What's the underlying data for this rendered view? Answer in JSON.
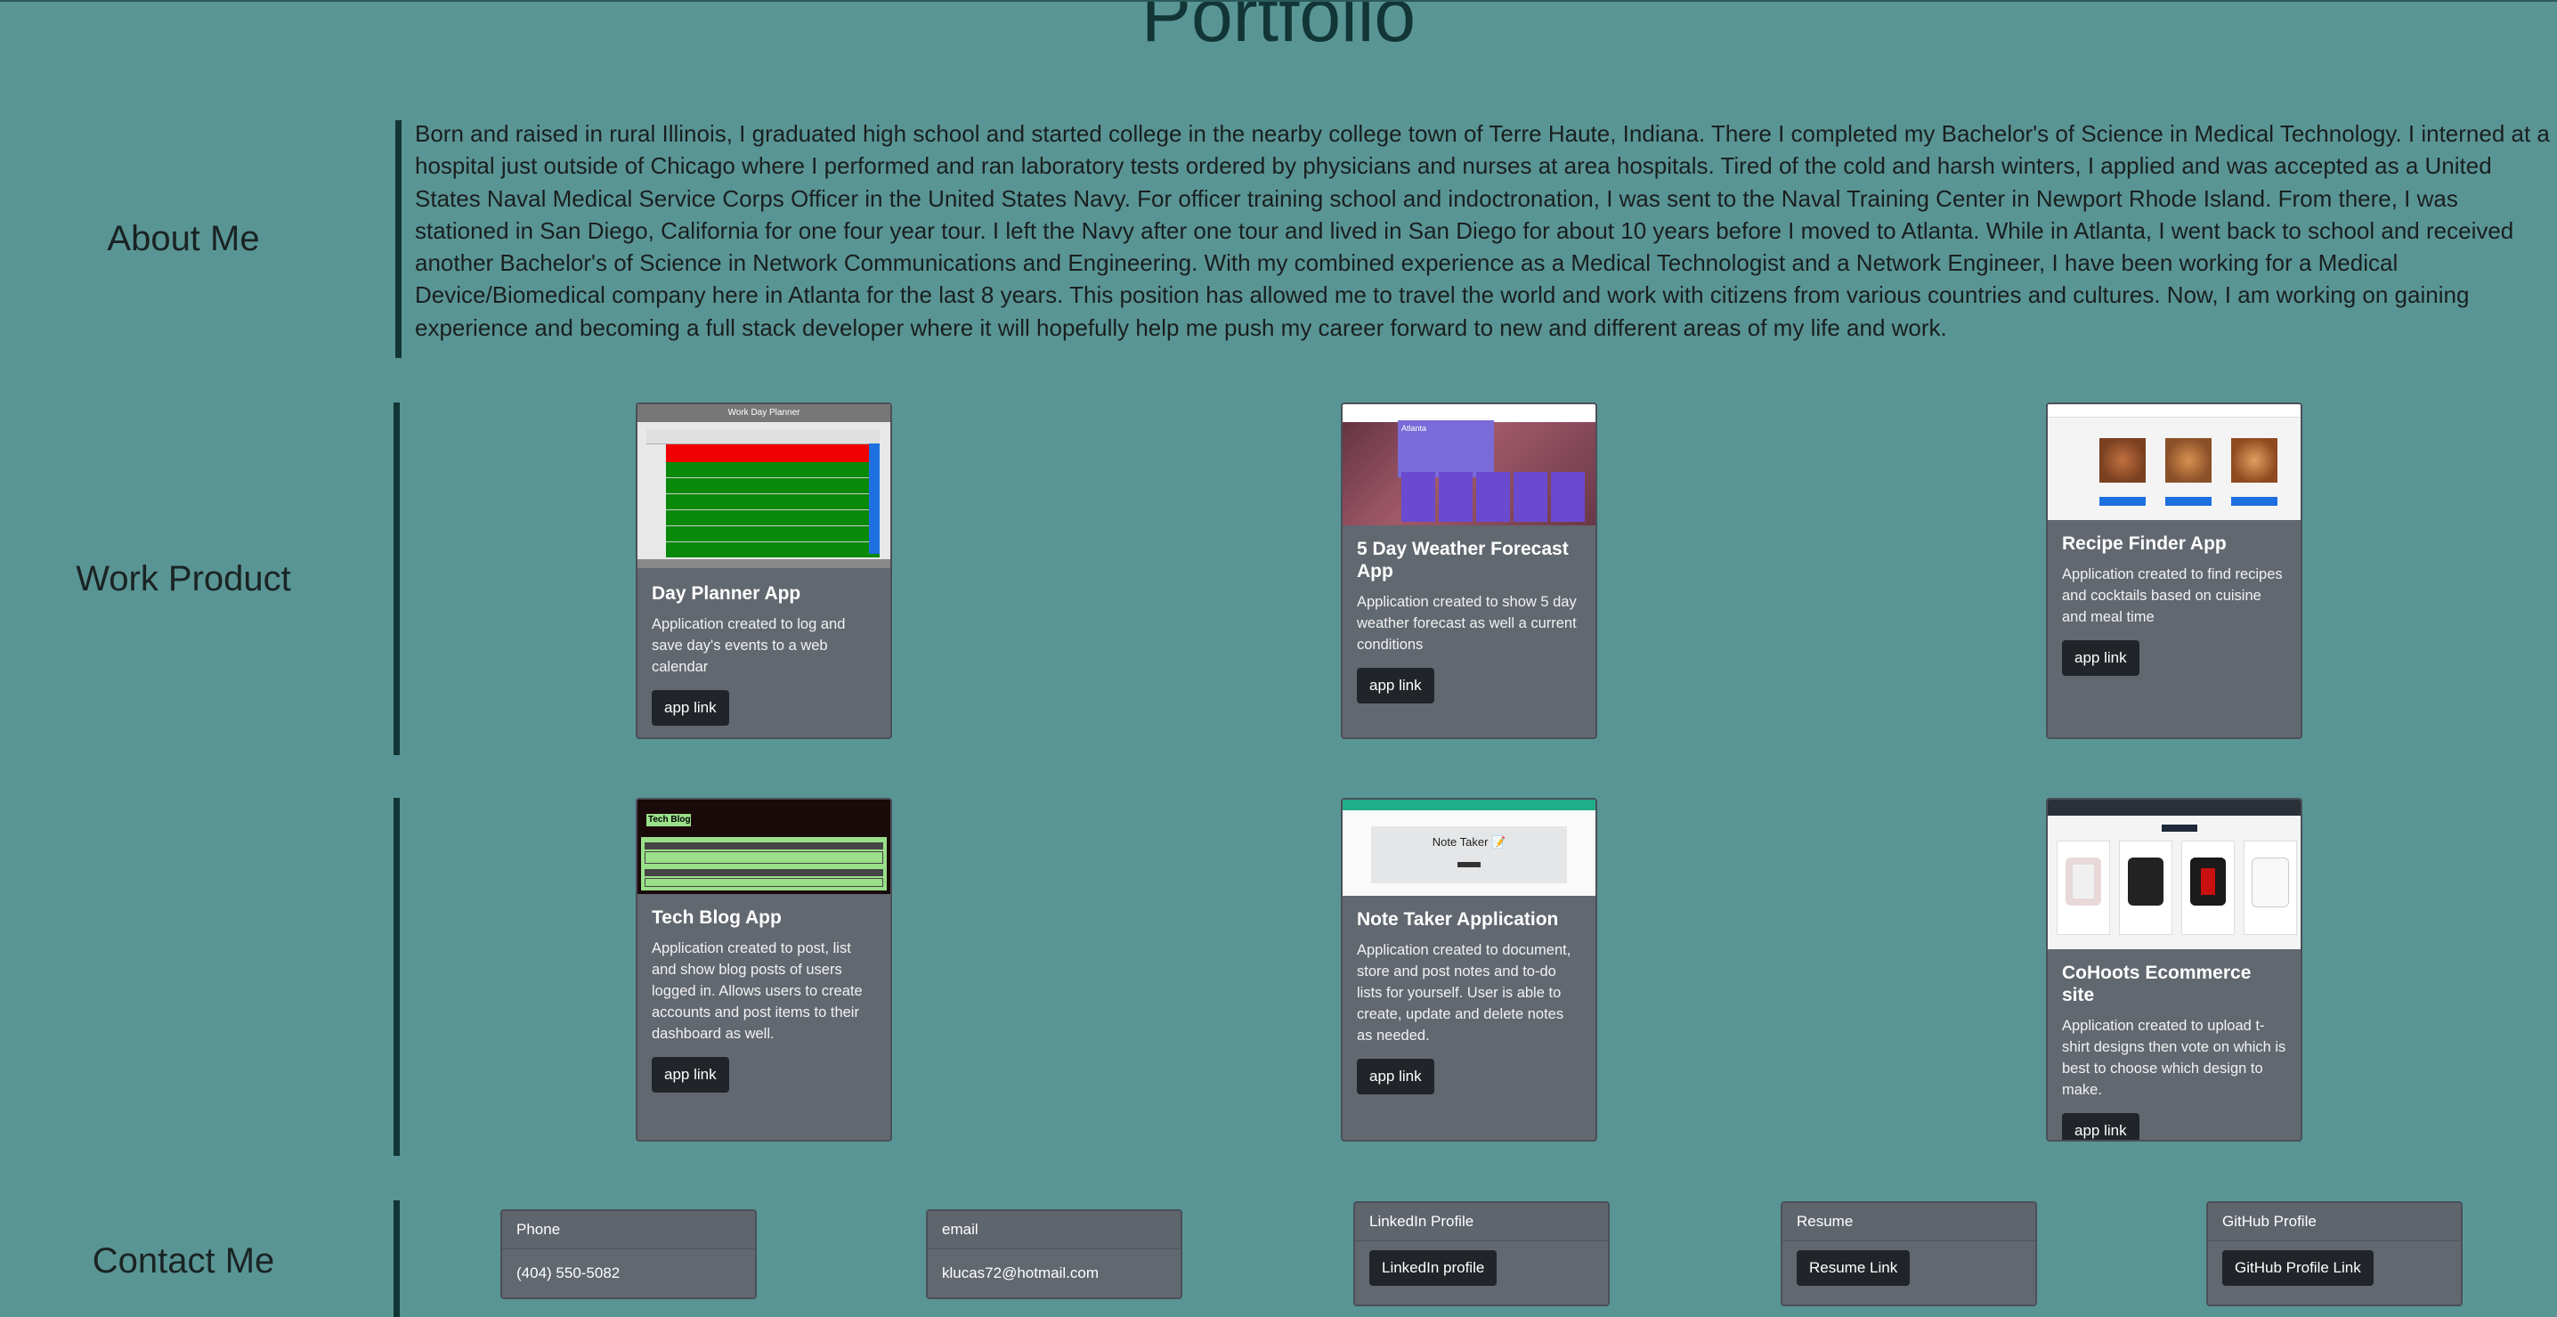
{
  "page": {
    "title": "Portfolio"
  },
  "colors": {
    "background": "#5a9595",
    "accent_bar": "#123535",
    "card_bg": "#626870",
    "button_bg": "#212529"
  },
  "about": {
    "heading": "About Me",
    "text": "Born and raised in rural Illinois, I graduated high school and started college in the nearby college town of Terre Haute, Indiana. There I completed my Bachelor's of Science in Medical Technology. I interned at a hospital just outside of Chicago where I performed and ran laboratory tests ordered by physicians and nurses at area hospitals. Tired of the cold and harsh winters, I applied and was accepted as a United States Naval Medical Service Corps Officer in the United States Navy. For officer training school and indoctronation, I was sent to the Naval Training Center in Newport Rhode Island. From there, I was stationed in San Diego, California for one four year tour. I left the Navy after one tour and lived in San Diego for about 10 years before I moved to Atlanta. While in Atlanta, I went back to school and received another Bachelor's of Science in Network Communications and Engineering. With my combined experience as a Medical Technologist and a Network Engineer, I have been working for a Medical Device/Biomedical company here in Atlanta for the last 8 years. This position has allowed me to travel the world and work with citizens from various countries and cultures. Now, I am working on gaining experience and becoming a full stack developer where it will hopefully help me push my career forward to new and different areas of my life and work."
  },
  "work": {
    "heading": "Work Product",
    "projects": [
      {
        "title": "Day Planner App",
        "description": "Application created to log and save day's events to a web calendar",
        "link_label": "app link",
        "thumb_title": "Work Day Planner"
      },
      {
        "title": "5 Day Weather Forecast App",
        "description": "Application created to show 5 day weather forecast as well a current conditions",
        "link_label": "app link",
        "thumb_title": "Atlanta"
      },
      {
        "title": "Recipe Finder App",
        "description": "Application created to find recipes and cocktails based on cuisine and meal time",
        "link_label": "app link",
        "thumb_title": ""
      },
      {
        "title": "Tech Blog App",
        "description": "Application created to post, list and show blog posts of users logged in. Allows users to create accounts and post items to their dashboard as well.",
        "link_label": "app link",
        "thumb_title": "Tech Blog"
      },
      {
        "title": "Note Taker Application",
        "description": "Application created to document, store and post notes and to-do lists for yourself. User is able to create, update and delete notes as needed.",
        "link_label": "app link",
        "thumb_title": "Note Taker 📝"
      },
      {
        "title": "CoHoots Ecommerce site",
        "description": "Application created to upload t-shirt designs then vote on which is best to choose which design to make.",
        "link_label": "app link",
        "thumb_title": ""
      }
    ]
  },
  "contact": {
    "heading": "Contact Me",
    "items": [
      {
        "header": "Phone",
        "value": "(404) 550-5082"
      },
      {
        "header": "email",
        "value": "klucas72@hotmail.com"
      },
      {
        "header": "LinkedIn Profile",
        "value": "LinkedIn profile"
      },
      {
        "header": "Resume",
        "value": "Resume Link"
      },
      {
        "header": "GitHub Profile",
        "value": "GitHub Profile Link"
      }
    ]
  }
}
